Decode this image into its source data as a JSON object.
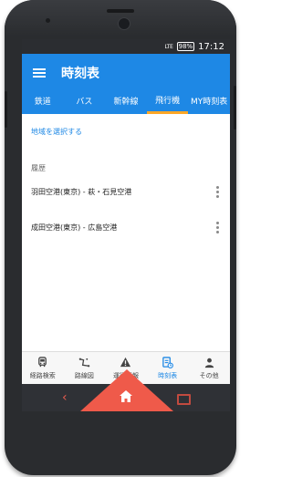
{
  "status_bar": {
    "network": "LTE",
    "battery": "98%",
    "time": "17:12"
  },
  "app_bar": {
    "title": "時刻表"
  },
  "tabs": [
    {
      "label": "鉄道"
    },
    {
      "label": "バス"
    },
    {
      "label": "新幹線"
    },
    {
      "label": "飛行機"
    },
    {
      "label": "MY時刻表"
    }
  ],
  "active_tab": "飛行機",
  "content": {
    "region_link": "地域を選択する",
    "history_header": "履歴",
    "history": [
      {
        "route": "羽田空港(東京) - 萩・石見空港"
      },
      {
        "route": "成田空港(東京) - 広島空港"
      }
    ]
  },
  "bottom_nav": [
    {
      "label": "経路検索",
      "icon": "bus-icon"
    },
    {
      "label": "路線図",
      "icon": "route-map-icon"
    },
    {
      "label": "運行情報",
      "icon": "warning-icon"
    },
    {
      "label": "時刻表",
      "icon": "timetable-icon"
    },
    {
      "label": "その他",
      "icon": "person-icon"
    }
  ],
  "active_bottom": "時刻表",
  "colors": {
    "primary": "#1e88e5",
    "tab_indicator": "#ffa726",
    "home_button": "#ef5a4a"
  }
}
